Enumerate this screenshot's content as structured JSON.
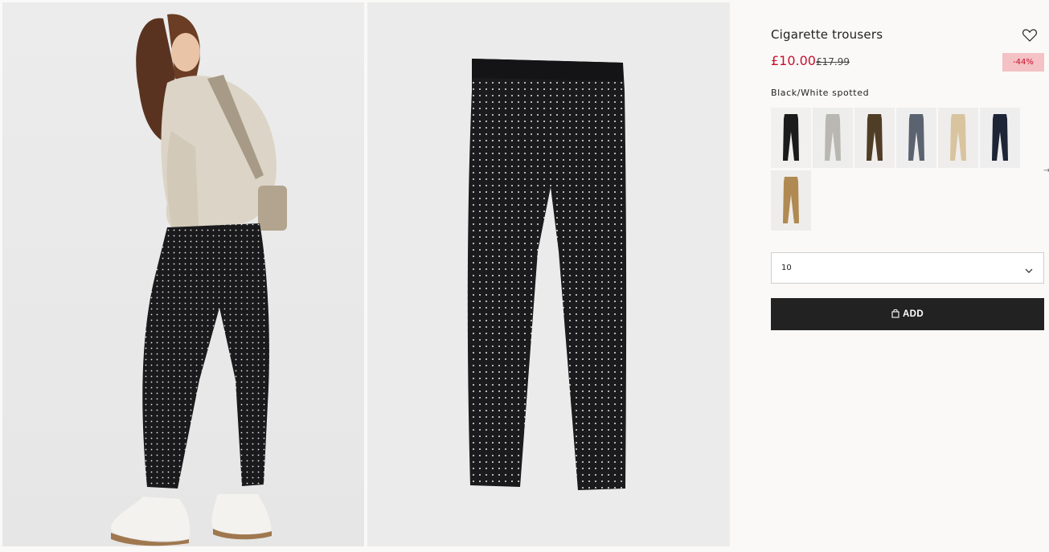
{
  "product": {
    "title": "Cigarette trousers",
    "price": "£10.00",
    "old_price": "£17.99",
    "discount": "-44%",
    "color_label": "Black/White spotted"
  },
  "swatches": [
    {
      "name": "Black",
      "color": "#1b1b1b",
      "bg": "#f1f0ee"
    },
    {
      "name": "Light grey",
      "color": "#b9b7b2",
      "bg": "#ededeb"
    },
    {
      "name": "Dark brown",
      "color": "#4f3d26",
      "bg": "#efeeec"
    },
    {
      "name": "Grey checked",
      "color": "#5c6370",
      "bg": "#eeeeee"
    },
    {
      "name": "Beige",
      "color": "#d9c4a0",
      "bg": "#efedeb"
    },
    {
      "name": "Dark blue",
      "color": "#1d2536",
      "bg": "#eeeeee"
    },
    {
      "name": "Camel",
      "color": "#b08a52",
      "bg": "#efedeb"
    }
  ],
  "size": {
    "selected": "10"
  },
  "actions": {
    "add_label": "ADD"
  },
  "icons": {
    "wishlist": "heart-icon",
    "dropdown": "chevron-down-icon",
    "bag": "shopping-bag-icon"
  },
  "colors": {
    "sale_red": "#c8102e",
    "discount_bg": "#f4c1c4",
    "button_bg": "#222222"
  }
}
